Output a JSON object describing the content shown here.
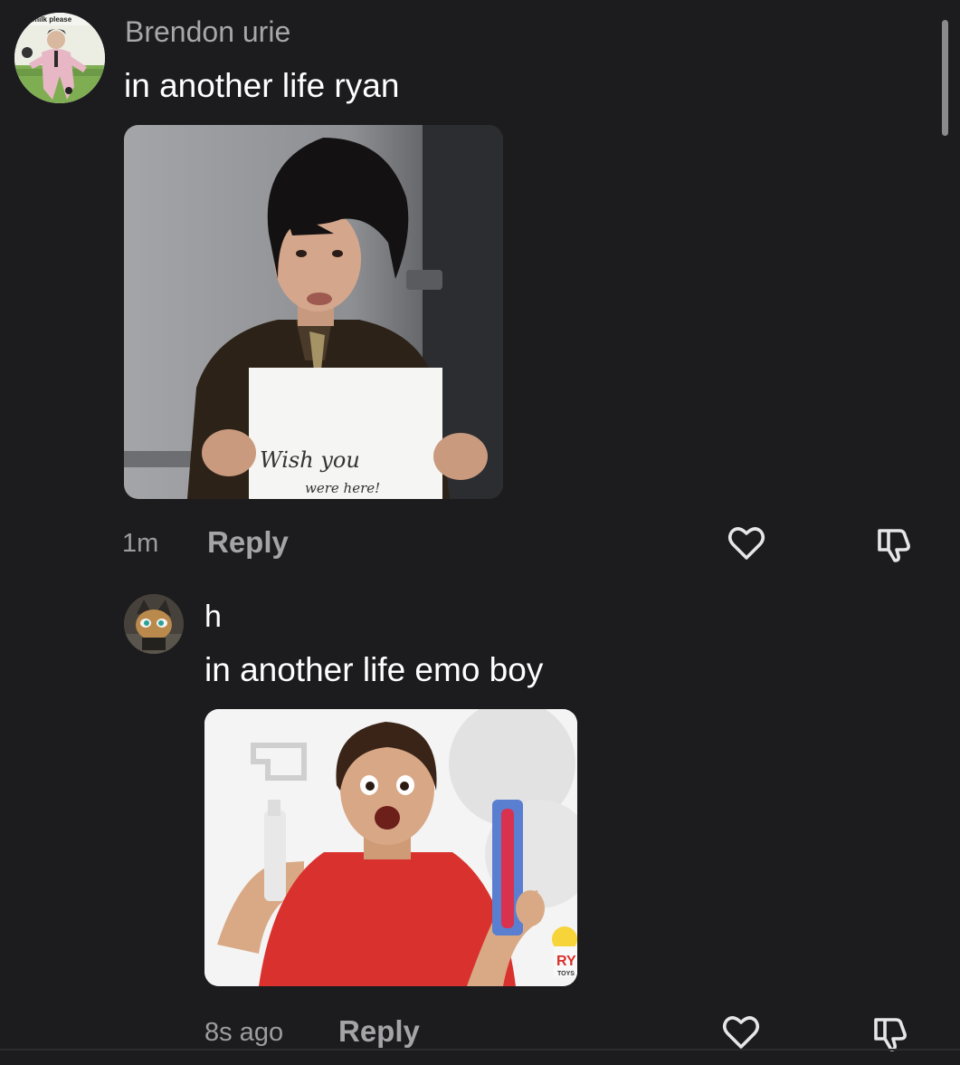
{
  "comments": [
    {
      "username": "Brendon urie",
      "avatar_caption": "milk please",
      "text": "in another life ryan",
      "image": {
        "sign_line1": "Wish you",
        "sign_line2": "were here!"
      },
      "time": "1m",
      "reply_label": "Reply",
      "icons": [
        "heart-icon",
        "dislike-icon"
      ]
    },
    {
      "username": "h",
      "text": "in another life emo boy",
      "image": {
        "logo_top": "RY",
        "logo_bottom": "TOYS"
      },
      "time": "8s ago",
      "reply_label": "Reply",
      "icons": [
        "heart-icon",
        "dislike-icon"
      ]
    }
  ],
  "theme": {
    "background": "#1c1c1e",
    "username_color": "#a7a7ab",
    "text_color": "#ffffff",
    "meta_color": "#9d9da1"
  }
}
